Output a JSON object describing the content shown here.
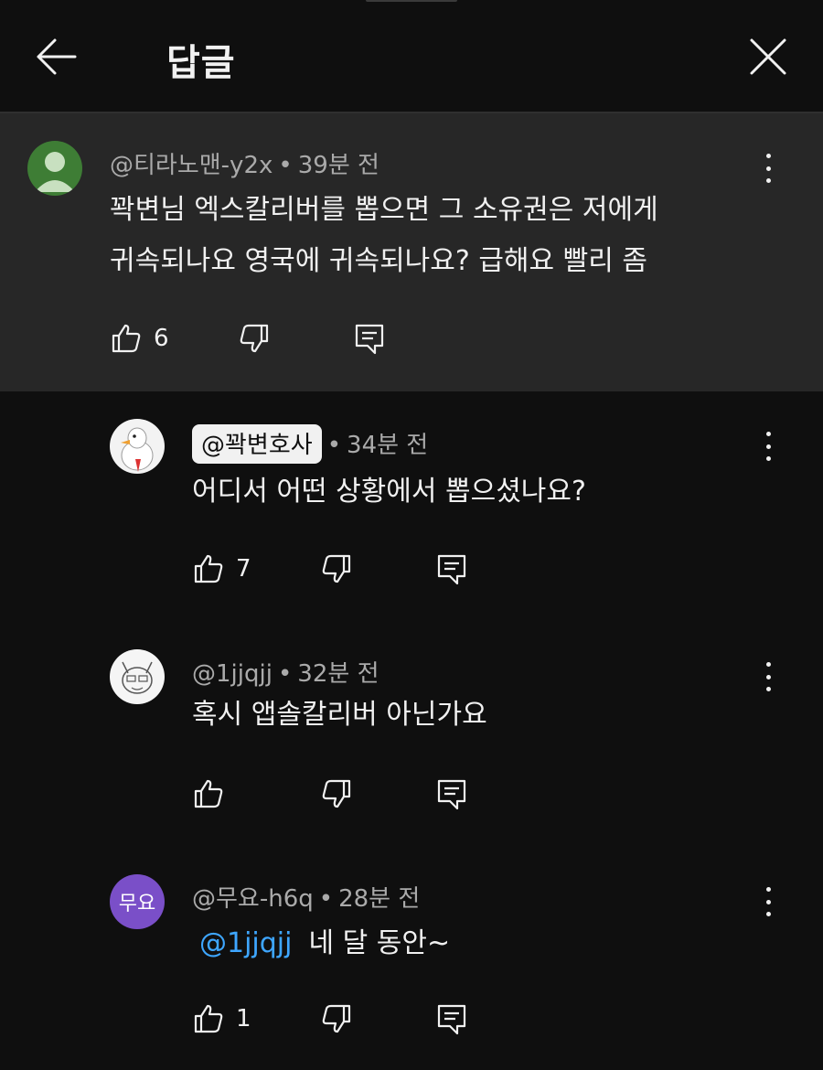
{
  "header": {
    "title": "답글"
  },
  "parent_comment": {
    "author": "@티라노맨-y2x",
    "time": "39분 전",
    "text_line1": "꽉변님 엑스칼리버를 뽑으면 그 소유권은 저에게",
    "text_line2": "귀속되나요 영국에 귀속되나요? 급해요 빨리 좀",
    "likes": "6"
  },
  "replies": [
    {
      "author": "@꽉변호사",
      "time": "34분 전",
      "text": "어디서 어떤 상황에서 뽑으셨나요?",
      "likes": "7"
    },
    {
      "author": "@1jjqjj",
      "time": "32분 전",
      "text": "혹시 앱솔칼리버 아닌가요",
      "likes": ""
    },
    {
      "author": "@무요-h6q",
      "avatar_text": "무요",
      "time": "28분 전",
      "mention": "@1jjqjj",
      "text": "네 달 동안~",
      "likes": "1"
    }
  ],
  "separator": "•",
  "colors": {
    "background": "#0f0f0f",
    "parent_background": "#272727",
    "mention": "#3ea6ff",
    "avatar_purple": "#7a4fc8",
    "avatar_green": "#3e7d35"
  }
}
